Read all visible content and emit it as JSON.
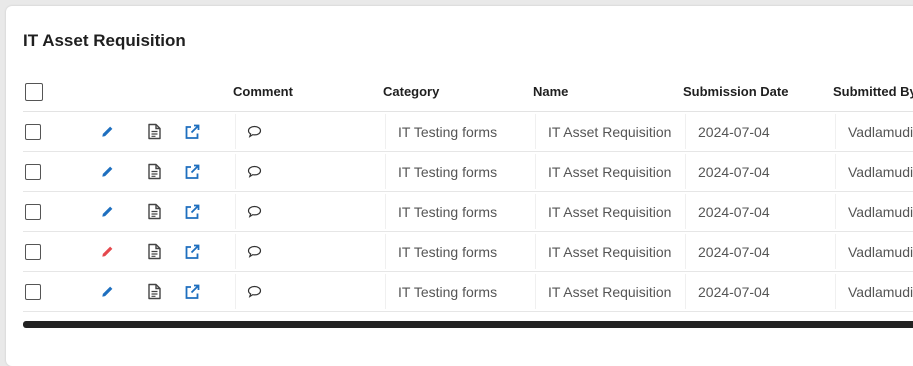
{
  "title": "IT Asset Requisition",
  "columns": {
    "comment": "Comment",
    "category": "Category",
    "name": "Name",
    "submission_date": "Submission Date",
    "submitted_by": "Submitted By"
  },
  "rows": [
    {
      "category": "IT Testing forms",
      "name": "IT Asset Requisition",
      "date": "2024-07-04",
      "submitted_by": "Vadlamudi,",
      "edit_color": "#1e6fbf"
    },
    {
      "category": "IT Testing forms",
      "name": "IT Asset Requisition",
      "date": "2024-07-04",
      "submitted_by": "Vadlamudi,",
      "edit_color": "#1e6fbf"
    },
    {
      "category": "IT Testing forms",
      "name": "IT Asset Requisition",
      "date": "2024-07-04",
      "submitted_by": "Vadlamudi,",
      "edit_color": "#1e6fbf"
    },
    {
      "category": "IT Testing forms",
      "name": "IT Asset Requisition",
      "date": "2024-07-04",
      "submitted_by": "Vadlamudi,",
      "edit_color": "#e5484d"
    },
    {
      "category": "IT Testing forms",
      "name": "IT Asset Requisition",
      "date": "2024-07-04",
      "submitted_by": "Vadlamudi,",
      "edit_color": "#1e6fbf"
    }
  ],
  "icons": {
    "edit": "pencil-icon",
    "document": "document-icon",
    "open": "external-link-icon",
    "comment": "comment-icon"
  },
  "colors": {
    "accent": "#1e6fbf",
    "edit_highlight": "#e5484d"
  }
}
